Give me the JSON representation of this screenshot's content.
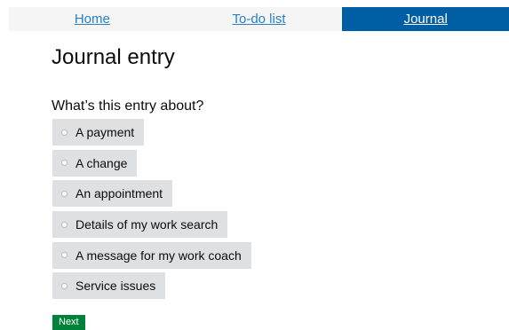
{
  "nav": {
    "tabs": [
      {
        "label": "Home",
        "active": false
      },
      {
        "label": "To-do list",
        "active": false
      },
      {
        "label": "Journal",
        "active": true
      }
    ]
  },
  "page": {
    "title": "Journal entry",
    "question": "What’s this entry about?"
  },
  "options": [
    {
      "label": "A payment"
    },
    {
      "label": "A change"
    },
    {
      "label": "An appointment"
    },
    {
      "label": "Details of my work search"
    },
    {
      "label": "A message for my work coach"
    },
    {
      "label": "Service issues"
    }
  ],
  "actions": {
    "next_label": "Next"
  },
  "colors": {
    "nav_active": "#005ea5",
    "nav_link": "#2b7fc4",
    "option_bg": "#dee0e2",
    "button_green": "#00823b"
  }
}
